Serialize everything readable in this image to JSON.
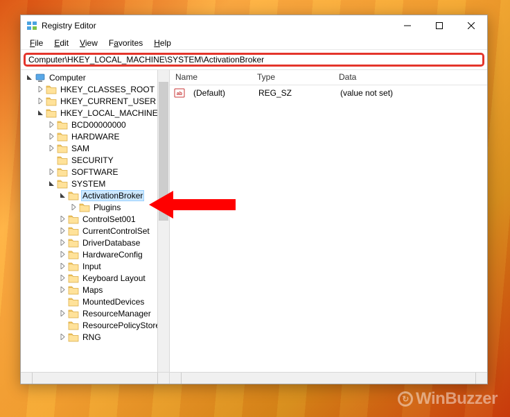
{
  "window": {
    "title": "Registry Editor"
  },
  "menubar": {
    "file": "File",
    "edit": "Edit",
    "view": "View",
    "favorites": "Favorites",
    "help": "Help"
  },
  "addressbar": {
    "value": "Computer\\HKEY_LOCAL_MACHINE\\SYSTEM\\ActivationBroker"
  },
  "tree": {
    "root": "Computer",
    "hives": [
      {
        "name": "HKEY_CLASSES_ROOT",
        "hasChildren": true,
        "expanded": false
      },
      {
        "name": "HKEY_CURRENT_USER",
        "hasChildren": true,
        "expanded": false
      },
      {
        "name": "HKEY_LOCAL_MACHINE",
        "hasChildren": true,
        "expanded": true
      }
    ],
    "hklm_children": [
      {
        "name": "BCD00000000",
        "hasChildren": true,
        "expanded": false
      },
      {
        "name": "HARDWARE",
        "hasChildren": true,
        "expanded": false
      },
      {
        "name": "SAM",
        "hasChildren": true,
        "expanded": false
      },
      {
        "name": "SECURITY",
        "hasChildren": false,
        "expanded": false
      },
      {
        "name": "SOFTWARE",
        "hasChildren": true,
        "expanded": false
      },
      {
        "name": "SYSTEM",
        "hasChildren": true,
        "expanded": true
      }
    ],
    "system_children": [
      {
        "name": "ActivationBroker",
        "hasChildren": true,
        "expanded": true,
        "selected": true
      },
      {
        "name": "ControlSet001",
        "hasChildren": true,
        "expanded": false
      },
      {
        "name": "CurrentControlSet",
        "hasChildren": true,
        "expanded": false
      },
      {
        "name": "DriverDatabase",
        "hasChildren": true,
        "expanded": false
      },
      {
        "name": "HardwareConfig",
        "hasChildren": true,
        "expanded": false
      },
      {
        "name": "Input",
        "hasChildren": true,
        "expanded": false
      },
      {
        "name": "Keyboard Layout",
        "hasChildren": true,
        "expanded": false
      },
      {
        "name": "Maps",
        "hasChildren": true,
        "expanded": false
      },
      {
        "name": "MountedDevices",
        "hasChildren": false,
        "expanded": false
      },
      {
        "name": "ResourceManager",
        "hasChildren": true,
        "expanded": false
      },
      {
        "name": "ResourcePolicyStore",
        "hasChildren": false,
        "expanded": false
      },
      {
        "name": "RNG",
        "hasChildren": true,
        "expanded": false
      }
    ],
    "activationbroker_children": [
      {
        "name": "Plugins",
        "hasChildren": true,
        "expanded": false
      }
    ]
  },
  "list": {
    "headers": {
      "name": "Name",
      "type": "Type",
      "data": "Data"
    },
    "rows": [
      {
        "name": "(Default)",
        "type": "REG_SZ",
        "data": "(value not set)"
      }
    ]
  },
  "watermark": "WinBuzzer"
}
